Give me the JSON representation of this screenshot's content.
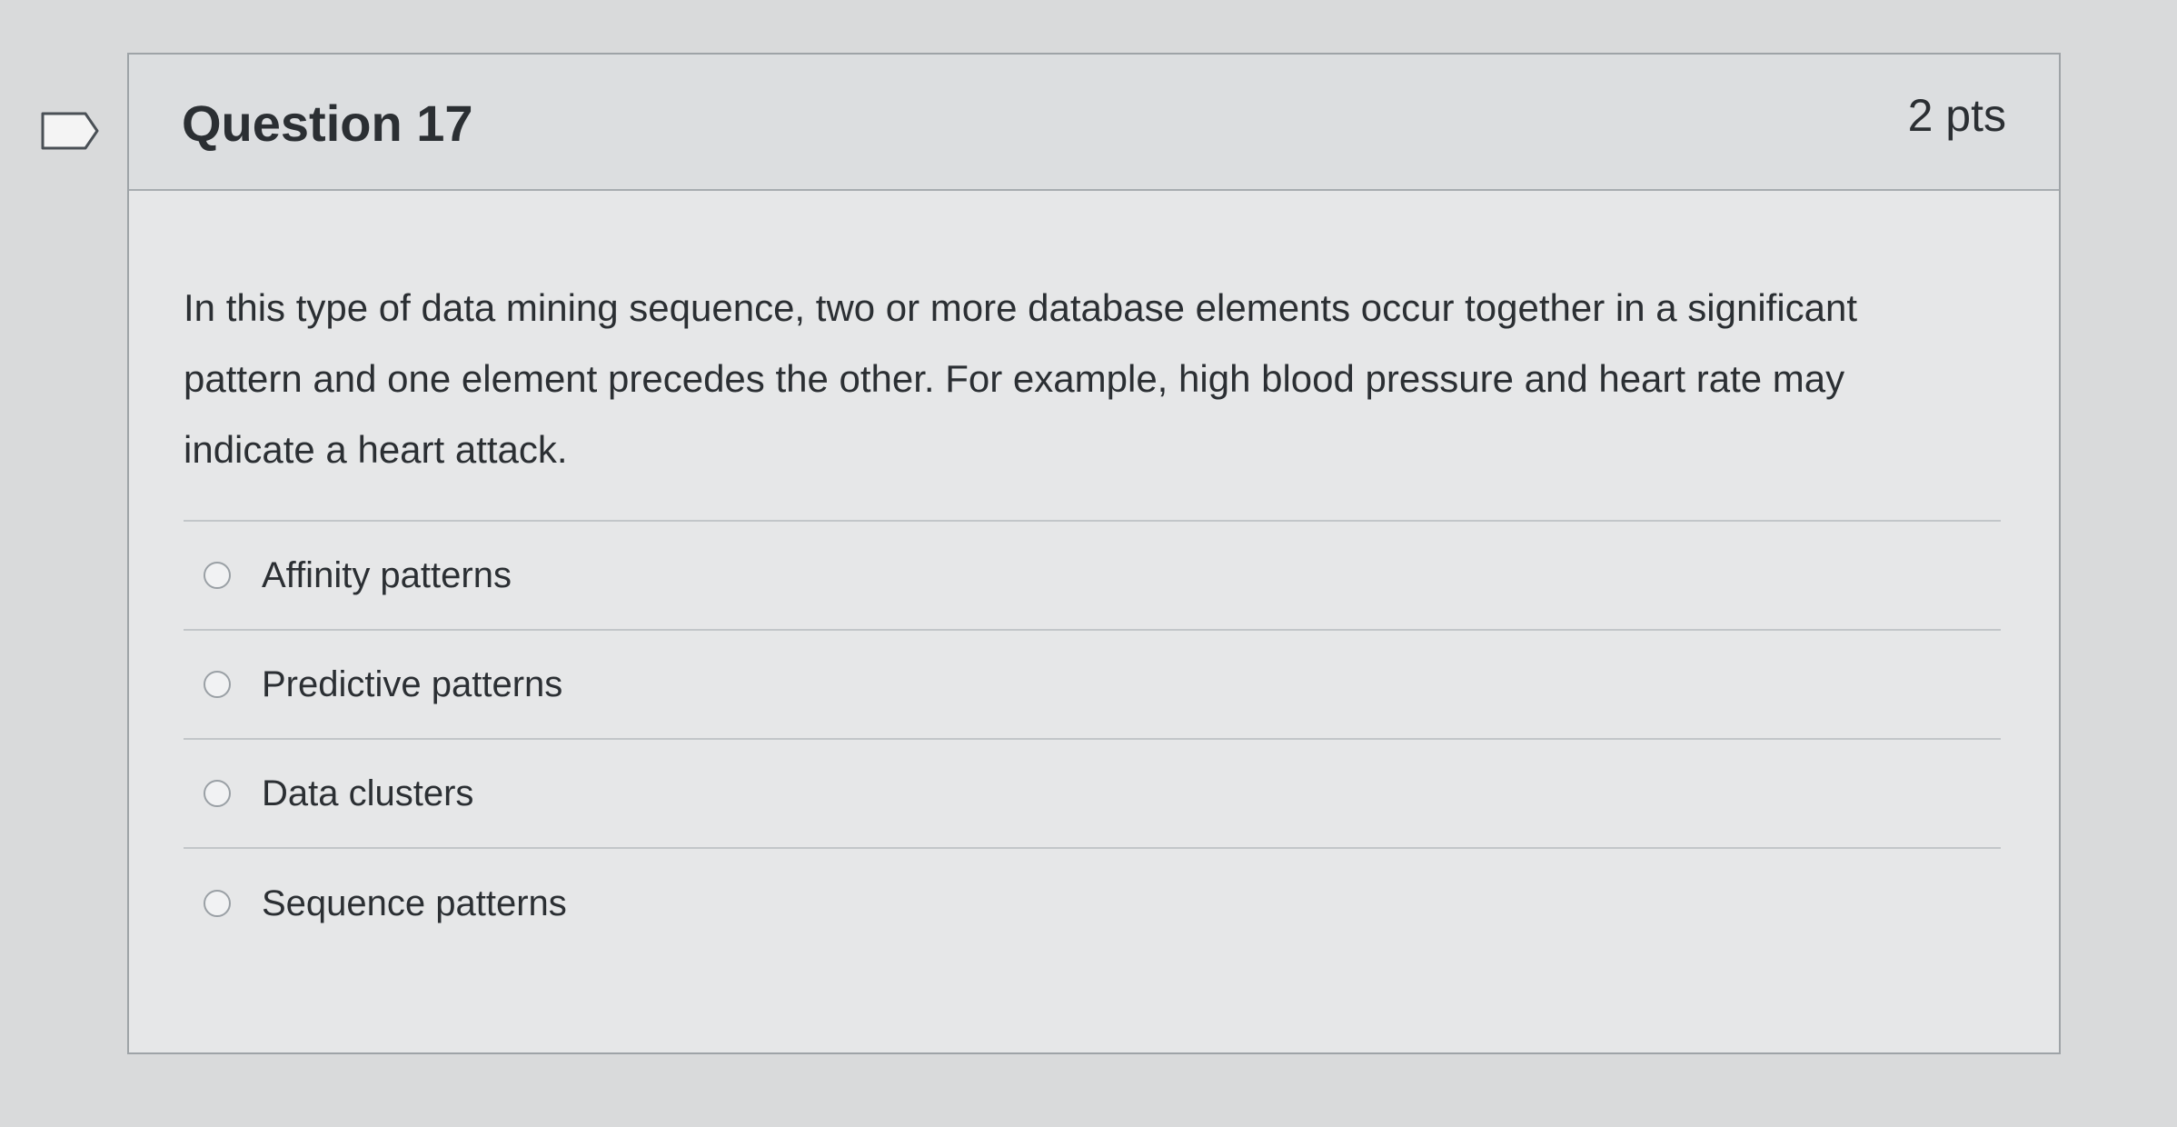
{
  "question": {
    "title": "Question 17",
    "points": "2 pts",
    "text": "In this type of data mining sequence, two or more database elements occur together in a significant pattern and one element precedes the other. For example, high blood pressure and heart rate may indicate a heart attack.",
    "flag_icon": "bookmark-flag-icon"
  },
  "answers": [
    {
      "label": "Affinity patterns",
      "selected": false
    },
    {
      "label": "Predictive patterns",
      "selected": false
    },
    {
      "label": "Data clusters",
      "selected": false
    },
    {
      "label": "Sequence patterns",
      "selected": false
    }
  ],
  "colors": {
    "page_background": "#d9dadb",
    "card_background": "#e6e7e8",
    "header_background": "#dcdee0",
    "text": "#2b2f33",
    "border": "#9ea3a7"
  }
}
